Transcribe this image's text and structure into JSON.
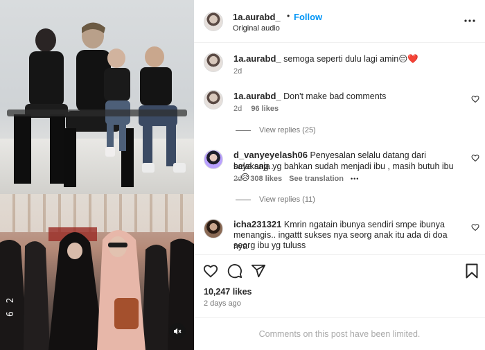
{
  "post": {
    "username": "1a.aurabd_",
    "follow_label": "Follow",
    "dot": "•",
    "audio": "Original audio",
    "more_icon": "more-horizontal-icon"
  },
  "comments": [
    {
      "username": "1a.aurabd_",
      "text": "semoga seperti dulu lagi amin😔❤️",
      "age": "2d"
    },
    {
      "username": "1a.aurabd_",
      "text": "Don't make bad comments",
      "age": "2d",
      "likes": "96 likes",
      "view_replies": "View replies (25)"
    },
    {
      "username": "d_vanyeyelash06",
      "text_line1": "Penyesalan selalu datang dari belakang ..",
      "text_line2": "saya saja yg bahkan sudah menjadi ibu , masih butuh ibu ...😥",
      "age": "2d",
      "likes": "308 likes",
      "see_translation": "See translation",
      "more": "•••",
      "view_replies": "View replies (11)"
    },
    {
      "username": "icha231321",
      "text_line1": "Kmrin ngatain ibunya sendiri smpe ibunya",
      "text_line2": "menangis.. ingattt sukses nya seorg anak itu ada di doa nya",
      "text_line3": "seorg ibu yg tuluss"
    }
  ],
  "footer": {
    "likes": "10,247 likes",
    "posted": "2 days ago",
    "limited": "Comments on this post have been limited."
  },
  "media": {
    "timestamp": "6 2"
  },
  "colors": {
    "accent": "#0095f6",
    "text": "#262626",
    "muted": "#737373"
  }
}
